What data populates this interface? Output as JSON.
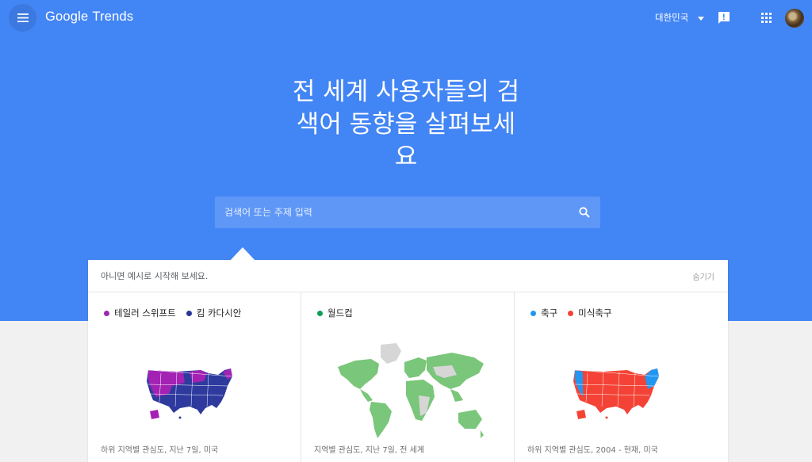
{
  "header": {
    "logo_google": "Google",
    "logo_trends": "Trends",
    "region": "대한민국"
  },
  "hero": {
    "line1": "전 세계 사용자들의 검",
    "line2": "색어 동향을 살펴보세",
    "line3": "요"
  },
  "search": {
    "placeholder": "검색어 또는 주제 입력"
  },
  "examples": {
    "title": "아니면 예시로 시작해 보세요.",
    "hide_label": "숨기기",
    "cards": [
      {
        "legend": [
          {
            "label": "테일러 스위프트",
            "color": "#9c27b0"
          },
          {
            "label": "킴 카다시안",
            "color": "#283593"
          }
        ],
        "caption": "하위 지역별 관심도, 지난 7일, 미국",
        "map_colors": [
          "#a322b4",
          "#2e3a9e"
        ]
      },
      {
        "legend": [
          {
            "label": "월드컵",
            "color": "#0f9d58"
          }
        ],
        "caption": "지역별 관심도, 지난 7일, 전 세계",
        "map_colors": [
          "#7ac67a",
          "#d6d6d6"
        ]
      },
      {
        "legend": [
          {
            "label": "축구",
            "color": "#2196f3"
          },
          {
            "label": "미식축구",
            "color": "#f44336"
          }
        ],
        "caption": "하위 지역별 관심도, 2004 - 현재, 미국",
        "map_colors": [
          "#f44336",
          "#2196f3"
        ]
      }
    ]
  }
}
